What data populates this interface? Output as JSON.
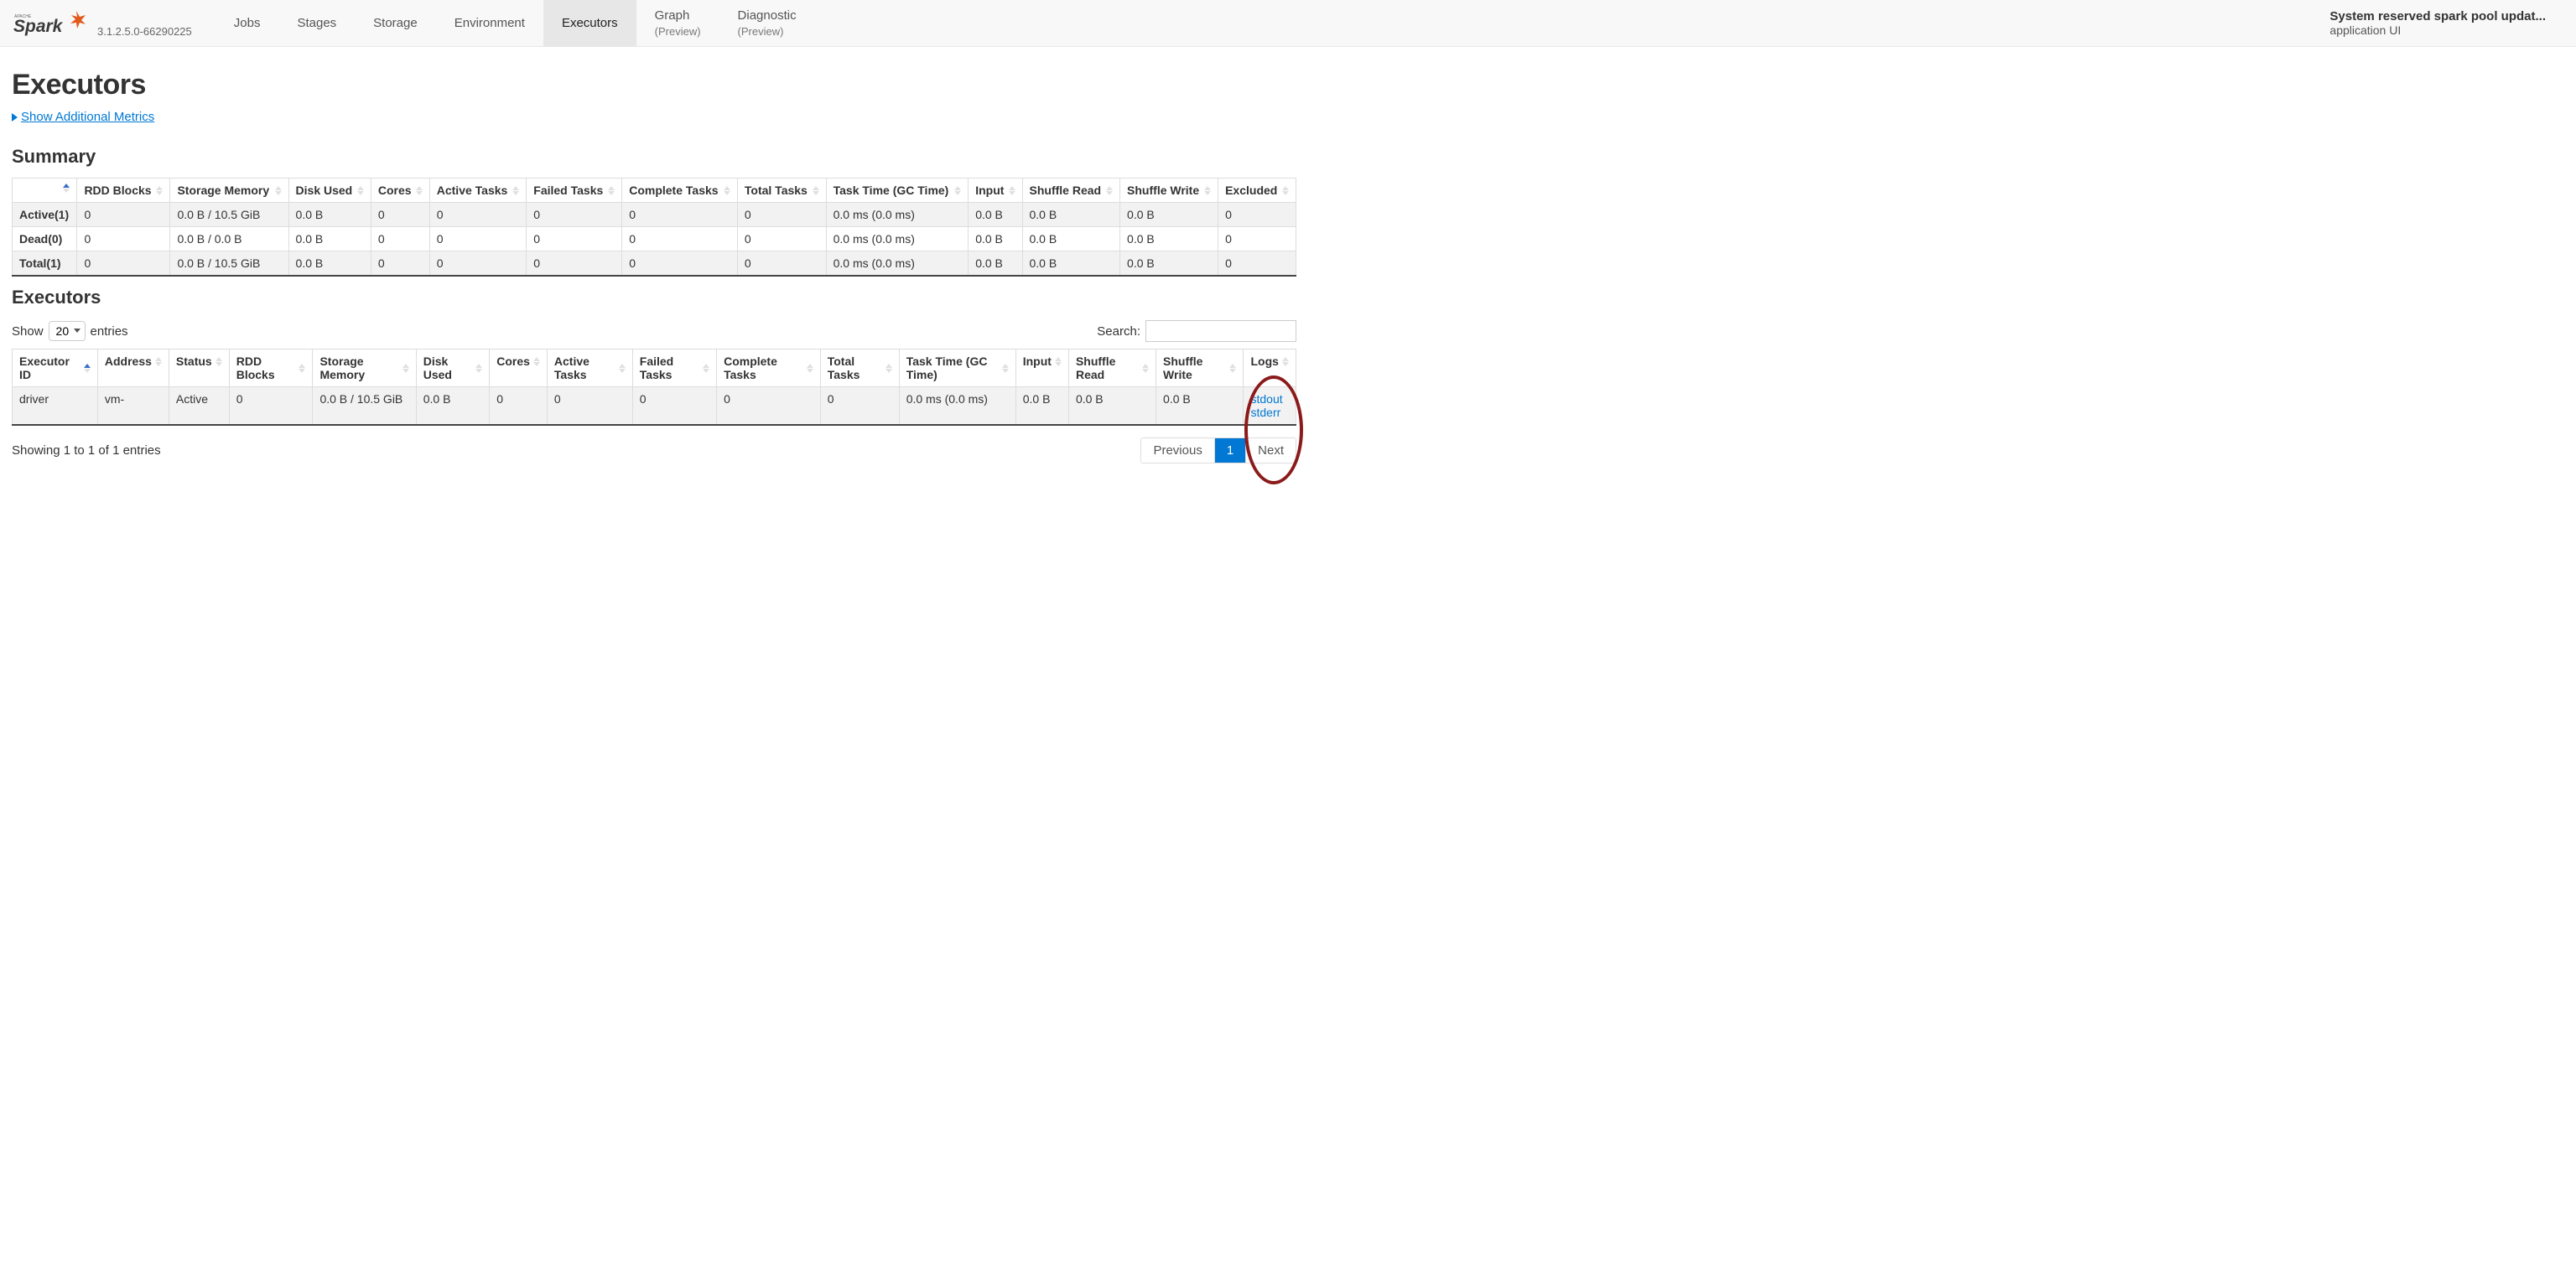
{
  "version": "3.1.2.5.0-66290225",
  "nav": {
    "tabs": [
      {
        "label": "Jobs",
        "active": false,
        "preview": ""
      },
      {
        "label": "Stages",
        "active": false,
        "preview": ""
      },
      {
        "label": "Storage",
        "active": false,
        "preview": ""
      },
      {
        "label": "Environment",
        "active": false,
        "preview": ""
      },
      {
        "label": "Executors",
        "active": true,
        "preview": ""
      },
      {
        "label": "Graph",
        "active": false,
        "preview": "(Preview)"
      },
      {
        "label": "Diagnostic",
        "active": false,
        "preview": "(Preview)"
      }
    ],
    "app_title": "System reserved spark pool updat...",
    "app_sub": "application UI"
  },
  "page": {
    "title": "Executors",
    "toggle_label": "Show Additional Metrics",
    "summary_heading": "Summary",
    "executors_heading": "Executors"
  },
  "summary_table": {
    "headers": [
      "",
      "RDD Blocks",
      "Storage Memory",
      "Disk Used",
      "Cores",
      "Active Tasks",
      "Failed Tasks",
      "Complete Tasks",
      "Total Tasks",
      "Task Time (GC Time)",
      "Input",
      "Shuffle Read",
      "Shuffle Write",
      "Excluded"
    ],
    "rows": [
      {
        "label": "Active(1)",
        "cells": [
          "0",
          "0.0 B / 10.5 GiB",
          "0.0 B",
          "0",
          "0",
          "0",
          "0",
          "0",
          "0.0 ms (0.0 ms)",
          "0.0 B",
          "0.0 B",
          "0.0 B",
          "0"
        ]
      },
      {
        "label": "Dead(0)",
        "cells": [
          "0",
          "0.0 B / 0.0 B",
          "0.0 B",
          "0",
          "0",
          "0",
          "0",
          "0",
          "0.0 ms (0.0 ms)",
          "0.0 B",
          "0.0 B",
          "0.0 B",
          "0"
        ]
      },
      {
        "label": "Total(1)",
        "cells": [
          "0",
          "0.0 B / 10.5 GiB",
          "0.0 B",
          "0",
          "0",
          "0",
          "0",
          "0",
          "0.0 ms (0.0 ms)",
          "0.0 B",
          "0.0 B",
          "0.0 B",
          "0"
        ]
      }
    ]
  },
  "controls": {
    "show_label_prefix": "Show",
    "show_value": "20",
    "show_label_suffix": "entries",
    "search_label": "Search:"
  },
  "exec_table": {
    "headers": [
      "Executor ID",
      "Address",
      "Status",
      "RDD Blocks",
      "Storage Memory",
      "Disk Used",
      "Cores",
      "Active Tasks",
      "Failed Tasks",
      "Complete Tasks",
      "Total Tasks",
      "Task Time (GC Time)",
      "Input",
      "Shuffle Read",
      "Shuffle Write",
      "Logs"
    ],
    "rows": [
      {
        "cells": [
          "driver",
          "vm-",
          "Active",
          "0",
          "0.0 B / 10.5 GiB",
          "0.0 B",
          "0",
          "0",
          "0",
          "0",
          "0",
          "0.0 ms (0.0 ms)",
          "0.0 B",
          "0.0 B",
          "0.0 B"
        ],
        "logs": {
          "stdout": "stdout",
          "stderr": "stderr"
        }
      }
    ]
  },
  "footer": {
    "info": "Showing 1 to 1 of 1 entries",
    "prev": "Previous",
    "page": "1",
    "next": "Next"
  }
}
